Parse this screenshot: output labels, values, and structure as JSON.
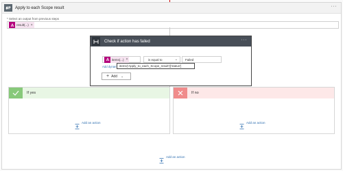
{
  "foreach": {
    "title": "Apply to each Scope result",
    "previous_label": "* Select an output from previous steps",
    "token_label": "result(...)",
    "token_remove": "×"
  },
  "condition": {
    "title": "Check if action has failed",
    "left_token_label": "items(...)",
    "token_remove": "×",
    "operator": "is equal to",
    "value": "Failed",
    "dynamic_content_link": "Add dynamic co",
    "tooltip": "items('Apply_to_each_Scope_result')['status']",
    "add_label": "Add"
  },
  "branches": {
    "yes_label": "If yes",
    "no_label": "If no"
  },
  "add_action_label": "Add an action",
  "colors": {
    "token_icon": "#b4057d",
    "token_bg": "#f6e3f0",
    "yes_icon": "#87c97a",
    "no_icon": "#f08b8b",
    "link": "#2f6fb0",
    "condition_header": "#484f58"
  },
  "icons": {
    "foreach": "loop-icon",
    "token": "dynamic-content-icon",
    "condition": "condition-icon",
    "yes": "check-icon",
    "no": "x-icon",
    "add_action": "add-step-icon"
  }
}
